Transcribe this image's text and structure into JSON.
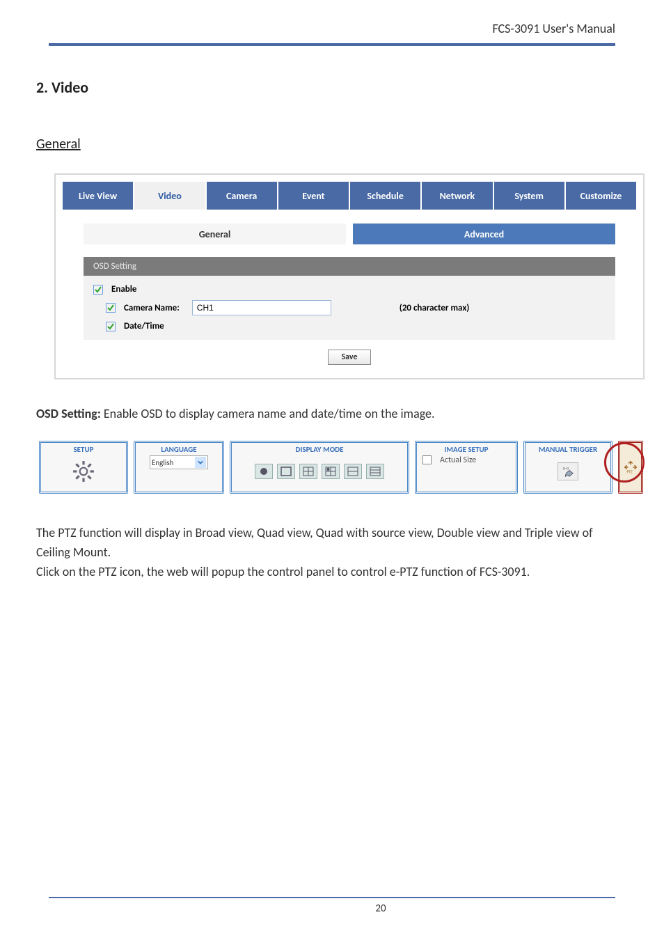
{
  "doc": {
    "running_head": "FCS-3091 User's Manual",
    "page_number": "20",
    "section_heading": "2. Video",
    "subsection_heading": "General",
    "osd_paragraph_label": "OSD Setting:",
    "osd_paragraph_text": " Enable OSD to display camera name and date/time on the image.",
    "para2_line1": "The PTZ function will display in Broad view, Quad view, Quad with source view, Double view and Triple view of Ceiling Mount.",
    "para2_line2": "Click on the PTZ icon, the web will popup the control panel to control e-PTZ function of FCS-3091."
  },
  "shot1": {
    "tabs": {
      "live_view": "Live View",
      "video": "Video",
      "camera": "Camera",
      "event": "Event",
      "schedule": "Schedule",
      "network": "Network",
      "system": "System",
      "customize": "Customize"
    },
    "subtabs": {
      "general": "General",
      "advanced": "Advanced"
    },
    "osd": {
      "section_title": "OSD Setting",
      "enable_label": "Enable",
      "enable_checked": true,
      "camera_name_label": "Camera Name:",
      "camera_name_checked": true,
      "camera_name_value": "CH1",
      "char_max": "(20 character max)",
      "datetime_label": "Date/Time",
      "datetime_checked": true
    },
    "save_label": "Save"
  },
  "shot2": {
    "setup": {
      "title": "SETUP"
    },
    "language": {
      "title": "LANGUAGE",
      "value": "English"
    },
    "display": {
      "title": "DISPLAY MODE"
    },
    "image": {
      "title": "IMAGE SETUP",
      "actual_size_label": "Actual Size",
      "actual_size_checked": false
    },
    "trigger": {
      "title": "MANUAL TRIGGER",
      "icon_text": "0~0"
    },
    "ptz": {
      "label": "PTZ"
    }
  }
}
